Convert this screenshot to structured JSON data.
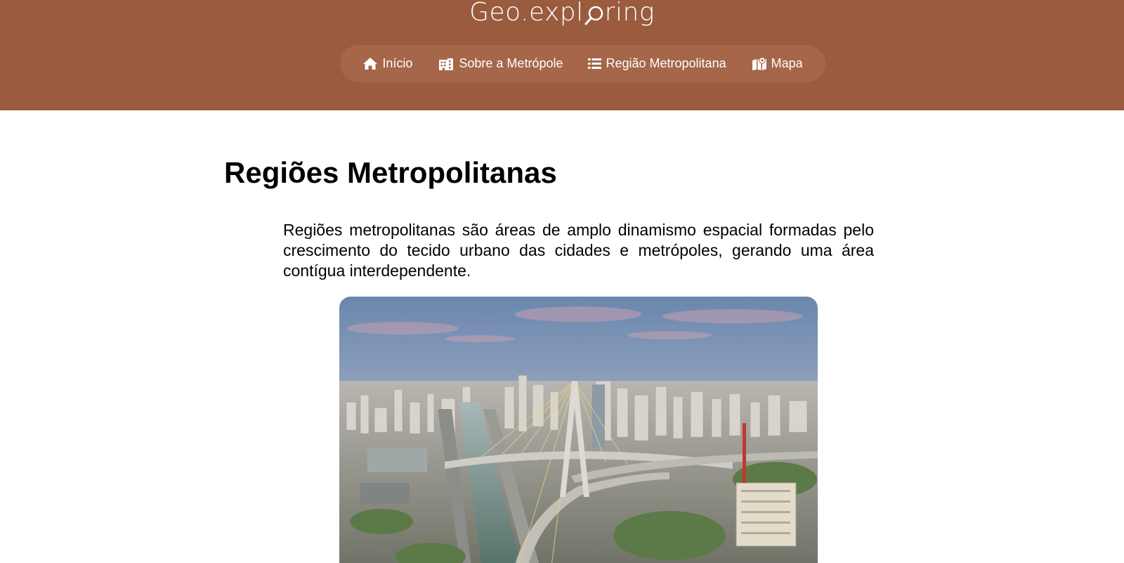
{
  "header": {
    "logo_prefix": "Geo.expl",
    "logo_suffix": "ring",
    "background": "#9a5b3f",
    "nav_background": "#a5664a"
  },
  "nav": {
    "items": [
      {
        "label": "Início",
        "icon": "home-icon"
      },
      {
        "label": "Sobre a Metrópole",
        "icon": "building-icon"
      },
      {
        "label": "Região Metropolitana",
        "icon": "list-icon"
      },
      {
        "label": "Mapa",
        "icon": "map-icon"
      }
    ]
  },
  "main": {
    "title": "Regiões Metropolitanas",
    "intro": "Regiões metropolitanas são áreas de amplo dinamismo espacial formadas pelo crescimento do tecido urbano das cidades e metrópoles, gerando uma área contígua interdependente.",
    "image_subject": "aerial-city-bridge-photo"
  }
}
